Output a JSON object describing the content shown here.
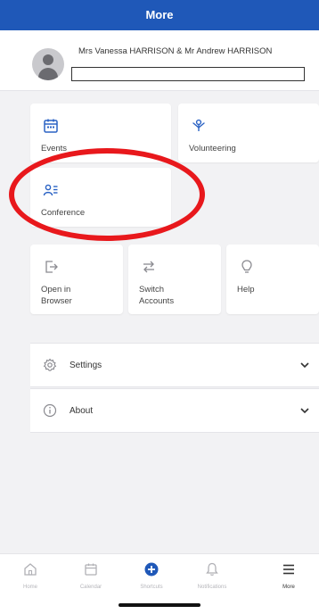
{
  "header": {
    "title": "More"
  },
  "profile": {
    "name": "Mrs Vanessa HARRISON & Mr Andrew HARRISON",
    "redacted_field": ""
  },
  "tiles_top": [
    {
      "label": "Events",
      "icon": "calendar-icon"
    },
    {
      "label": "Volunteering",
      "icon": "volunteer-icon"
    },
    {
      "label": "Conference",
      "icon": "people-list-icon"
    }
  ],
  "tiles_actions": [
    {
      "label": "Open in Browser",
      "icon": "open-external-icon"
    },
    {
      "label": "Switch Accounts",
      "icon": "switch-icon"
    },
    {
      "label": "Help",
      "icon": "lightbulb-icon"
    }
  ],
  "menu": [
    {
      "label": "Settings",
      "icon": "gear-icon"
    },
    {
      "label": "About",
      "icon": "info-icon"
    }
  ],
  "tabbar": [
    {
      "label": "Home",
      "icon": "home-icon"
    },
    {
      "label": "Calendar",
      "icon": "calendar-icon"
    },
    {
      "label": "Shortcuts",
      "icon": "plus-circle-icon"
    },
    {
      "label": "Notifications",
      "icon": "bell-icon"
    },
    {
      "label": "More",
      "icon": "menu-icon",
      "active": true
    }
  ],
  "colors": {
    "header_bg": "#1f58b8",
    "accent": "#1f58b8",
    "annotation": "#e8181c",
    "background": "#f2f2f4"
  }
}
